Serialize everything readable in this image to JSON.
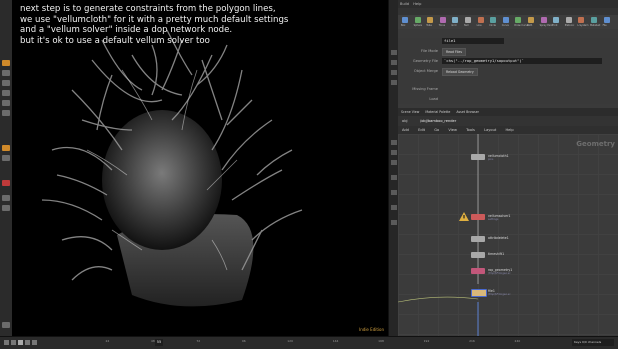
{
  "caption": {
    "lines": [
      "next step is to generate constraints from the polygon lines,",
      "we use \"vellumcloth\" for it with a pretty much default settings",
      "and a \"vellum solver\" inside a dop network node.",
      "but it's ok to use a default vellum solver too"
    ]
  },
  "viewport": {
    "corner_label": "Indie Edition"
  },
  "menubar": {
    "items": [
      "Build",
      "Help"
    ]
  },
  "shelf_tabs": [
    "Create",
    "Modify",
    "Model",
    "Polygon",
    "Deform",
    "Texture",
    "Rigging",
    "Characters",
    "Constraints",
    "Guide Process",
    "Terrain FX",
    "Simple FX",
    "Volume"
  ],
  "shelf_tools": [
    "Box",
    "Sphere",
    "Tube",
    "Torus",
    "Grid",
    "Null",
    "Line",
    "Circle",
    "Curve",
    "Draw Curve",
    "Path",
    "Spray Paint",
    "Font",
    "Platonic",
    "L-System",
    "Metaball",
    "File"
  ],
  "params": {
    "node_name": "file1",
    "file_mode_label": "File Mode",
    "file_mode_value": "Read Files",
    "geometry_file_label": "Geometry File",
    "geometry_file_value": "`chs(\"../rop_geometry1/sopoutput\")`",
    "object_merge_label": "Object Merge",
    "reload_label": "Reload Geometry",
    "missing_frame_label": "Missing Frame",
    "load_label": "Load"
  },
  "pane_tabs": [
    "Scene View",
    "Material Palette",
    "Asset Browser"
  ],
  "network": {
    "path": "/obj/bamboo_render",
    "obj_label": "obj",
    "menu": [
      "Add",
      "Edit",
      "Go",
      "View",
      "Tools",
      "Layout",
      "Help"
    ],
    "watermark": "Geometry",
    "nodes": [
      {
        "name": "vellumcloth1",
        "sub": "pins"
      },
      {
        "name": "vellumsolver1",
        "sub": "settings"
      },
      {
        "name": "attribdelete1",
        "sub": ""
      },
      {
        "name": "timeshift1",
        "sub": ""
      },
      {
        "name": "rop_geometry1",
        "sub": "/tmp/$F4.bgeo.sc"
      },
      {
        "name": "file1",
        "sub": "/tmp/$F4.bgeo.sc"
      }
    ]
  },
  "timeline": {
    "current_frame": "55",
    "tick_labels": [
      "24",
      "48",
      "72",
      "96",
      "120",
      "144",
      "168",
      "192",
      "216",
      "240"
    ],
    "end_label": "Keys 0/0 channels"
  }
}
